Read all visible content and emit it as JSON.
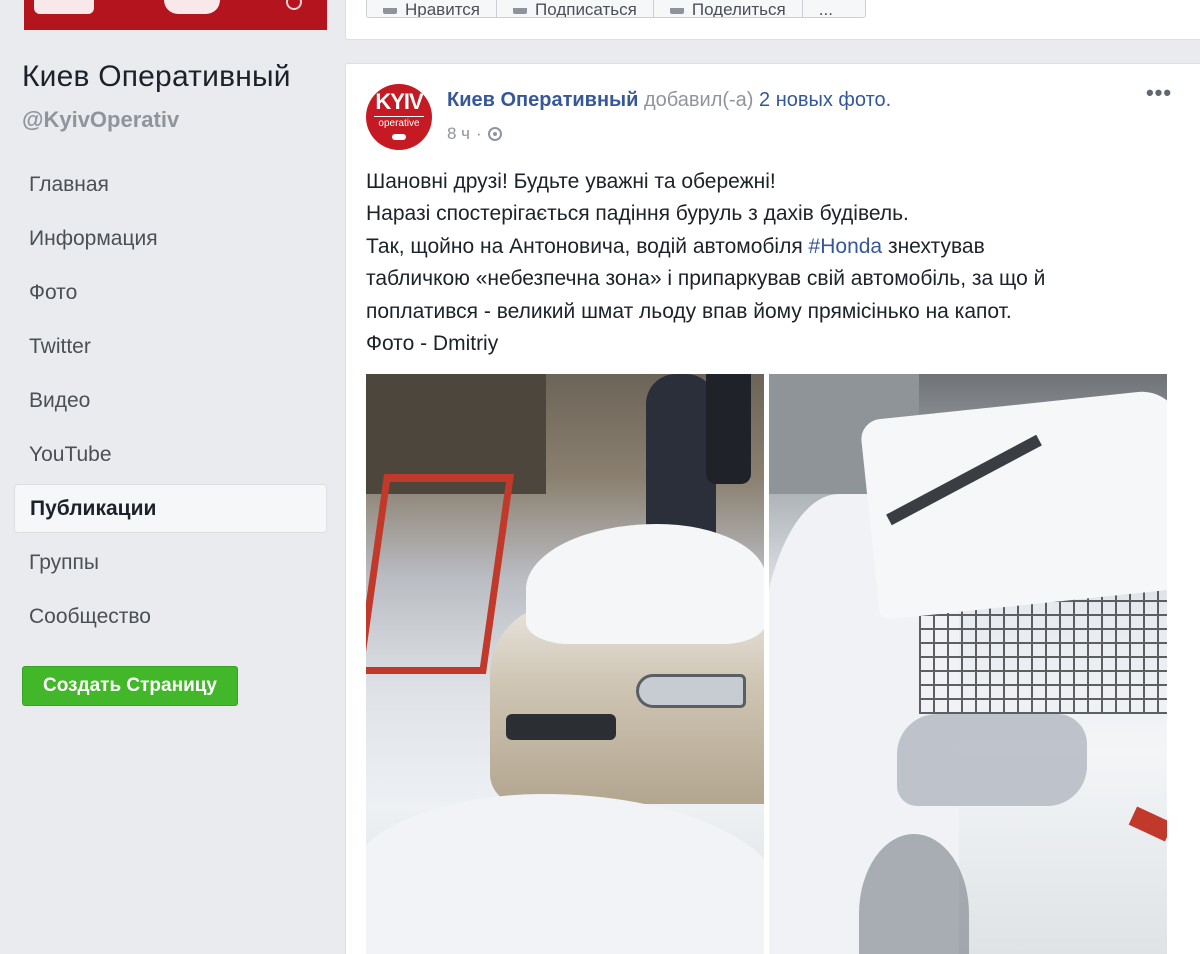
{
  "sidebar": {
    "page_name": "Киев Оперативный",
    "page_handle": "@KyivOperativ",
    "nav": [
      {
        "label": "Главная"
      },
      {
        "label": "Информация"
      },
      {
        "label": "Фото"
      },
      {
        "label": "Twitter"
      },
      {
        "label": "Видео"
      },
      {
        "label": "YouTube"
      },
      {
        "label": "Публикации",
        "active": true
      },
      {
        "label": "Группы"
      },
      {
        "label": "Сообщество"
      }
    ],
    "create_page_label": "Создать Страницу",
    "create_page_color": "#42b72a"
  },
  "top_actions": {
    "like_label": "Нравится",
    "follow_label": "Подписаться",
    "share_label": "Поделиться",
    "more_label": "..."
  },
  "post": {
    "avatar": {
      "text": "KYIV",
      "sub": "operative",
      "color": "#c51a24"
    },
    "author": "Киев Оперативный",
    "action": " добавил(-а) ",
    "photos_link": "2 новых фото.",
    "time": "8 ч",
    "meta_separator": "·",
    "more_label": "•••",
    "body": {
      "line1": "Шановні друзі! Будьте уважні та обережні!",
      "line2": "Наразі спостерігається падіння буруль з дахів будівель.",
      "line3_before": "Так, щойно на Антоновича, водій автомобіля ",
      "line3_hashtag": "#Honda",
      "line3_after": " знехтував",
      "line4": "табличкою «небезпечна зона» і припаркував свій автомобіль, за що й",
      "line4_full": "табличкою «небезпечна зона» і припаркував свій автомобіль, за що й",
      "line5": "поплатився - великий шмат льоду впав йому прямісінько на капот.",
      "line6": "Фото - Dmitriy"
    }
  },
  "colors": {
    "link": "#365899",
    "muted": "#90949c",
    "background": "#e9ebee",
    "brand_red": "#b3141e"
  }
}
